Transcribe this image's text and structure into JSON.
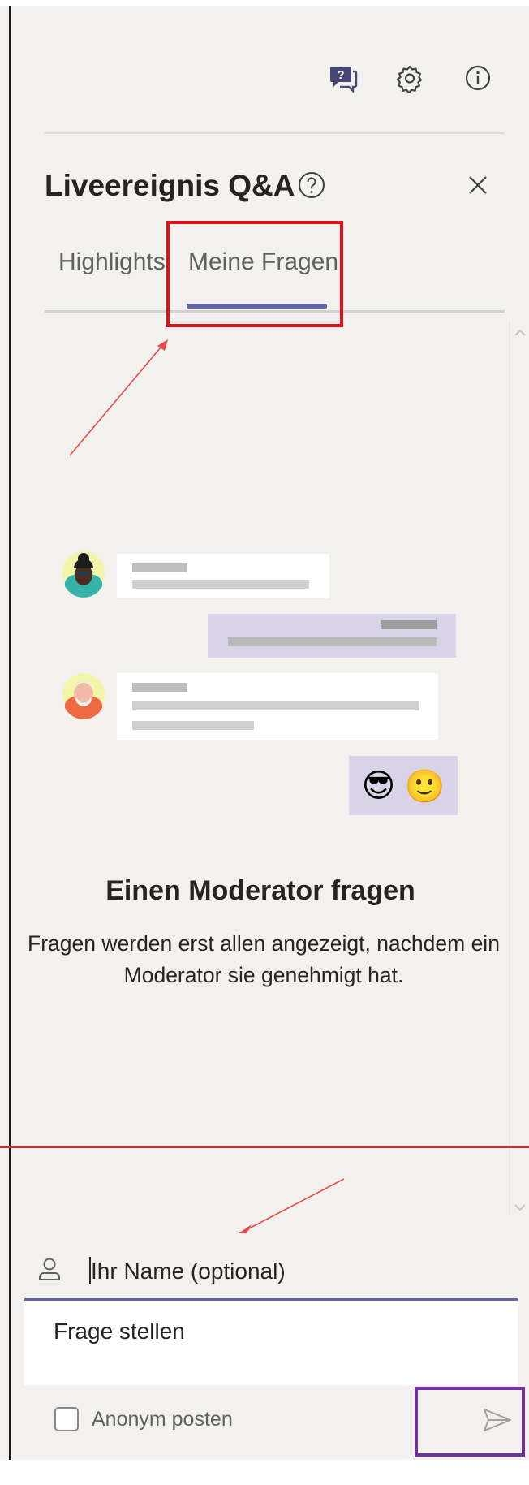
{
  "header_icons": [
    {
      "icon": "qna-icon",
      "active": true
    },
    {
      "icon": "gear-icon",
      "active": false
    },
    {
      "icon": "info-icon",
      "active": false
    }
  ],
  "panel": {
    "title": "Liveereignis Q&A",
    "help_icon": "question-circle-icon",
    "close_icon": "close-icon"
  },
  "tabs": [
    {
      "label": "Highlights",
      "selected": false
    },
    {
      "label": "Meine Fragen",
      "selected": true
    }
  ],
  "empty_state": {
    "title": "Einen Moderator fragen",
    "description": "Fragen werden erst allen angezeigt, nachdem ein Moderator sie genehmigt hat.",
    "emoji": [
      "😎",
      "🙂"
    ]
  },
  "compose": {
    "name_placeholder": "Ihr Name (optional)",
    "question_placeholder": "Frage stellen",
    "anonymous_label": "Anonym posten",
    "anonymous_checked": false,
    "send_icon": "send-icon"
  },
  "colors": {
    "accent": "#6264a7",
    "panel_bg": "#f3f1ee",
    "annotation_red": "#e0121d",
    "annotation_purple": "#7030a0"
  }
}
